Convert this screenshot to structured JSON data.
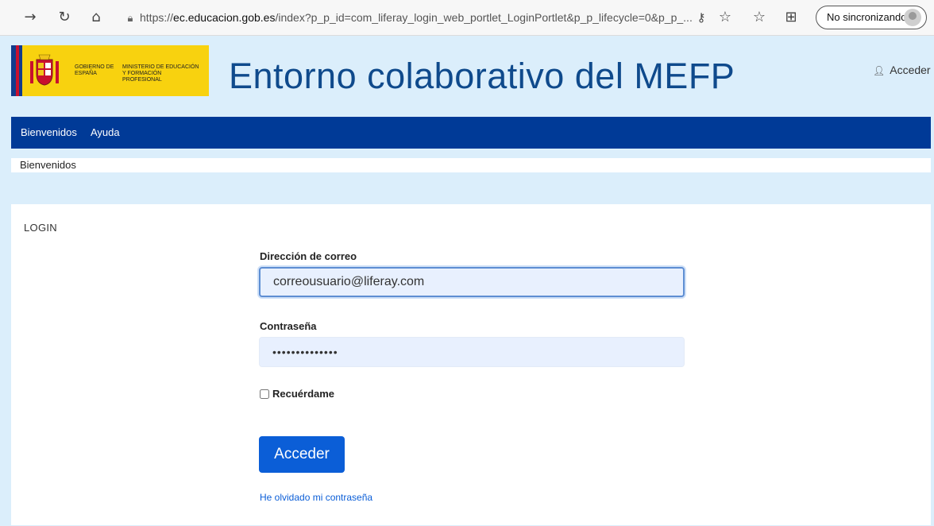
{
  "browser": {
    "url_prefix": "https://",
    "url_domain": "ec.educacion.gob.es",
    "url_rest": "/index?p_p_id=com_liferay_login_web_portlet_LoginPortlet&p_p_lifecycle=0&p_p_...",
    "sync_label": "No sincronizando"
  },
  "header": {
    "logo_gobierno": "GOBIERNO DE ESPAÑA",
    "logo_ministerio": "MINISTERIO DE EDUCACIÓN Y FORMACIÓN PROFESIONAL",
    "title": "Entorno colaborativo del MEFP",
    "sign_in": "Acceder"
  },
  "nav": {
    "items": [
      {
        "label": "Bienvenidos"
      },
      {
        "label": "Ayuda"
      }
    ]
  },
  "breadcrumb": "Bienvenidos",
  "login": {
    "title": "LOGIN",
    "email_label": "Dirección de correo",
    "email_value": "correousuario@liferay.com",
    "password_label": "Contraseña",
    "password_value": "••••••••••••••",
    "remember_label": "Recuérdame",
    "submit_label": "Acceder",
    "forgot_label": "He olvidado mi contraseña"
  },
  "colors": {
    "page_bg": "#dbeefb",
    "nav_bg": "#003a97",
    "title_color": "#0f4a8c",
    "button_bg": "#0b5ed7",
    "logo_bg": "#f8d20f"
  }
}
